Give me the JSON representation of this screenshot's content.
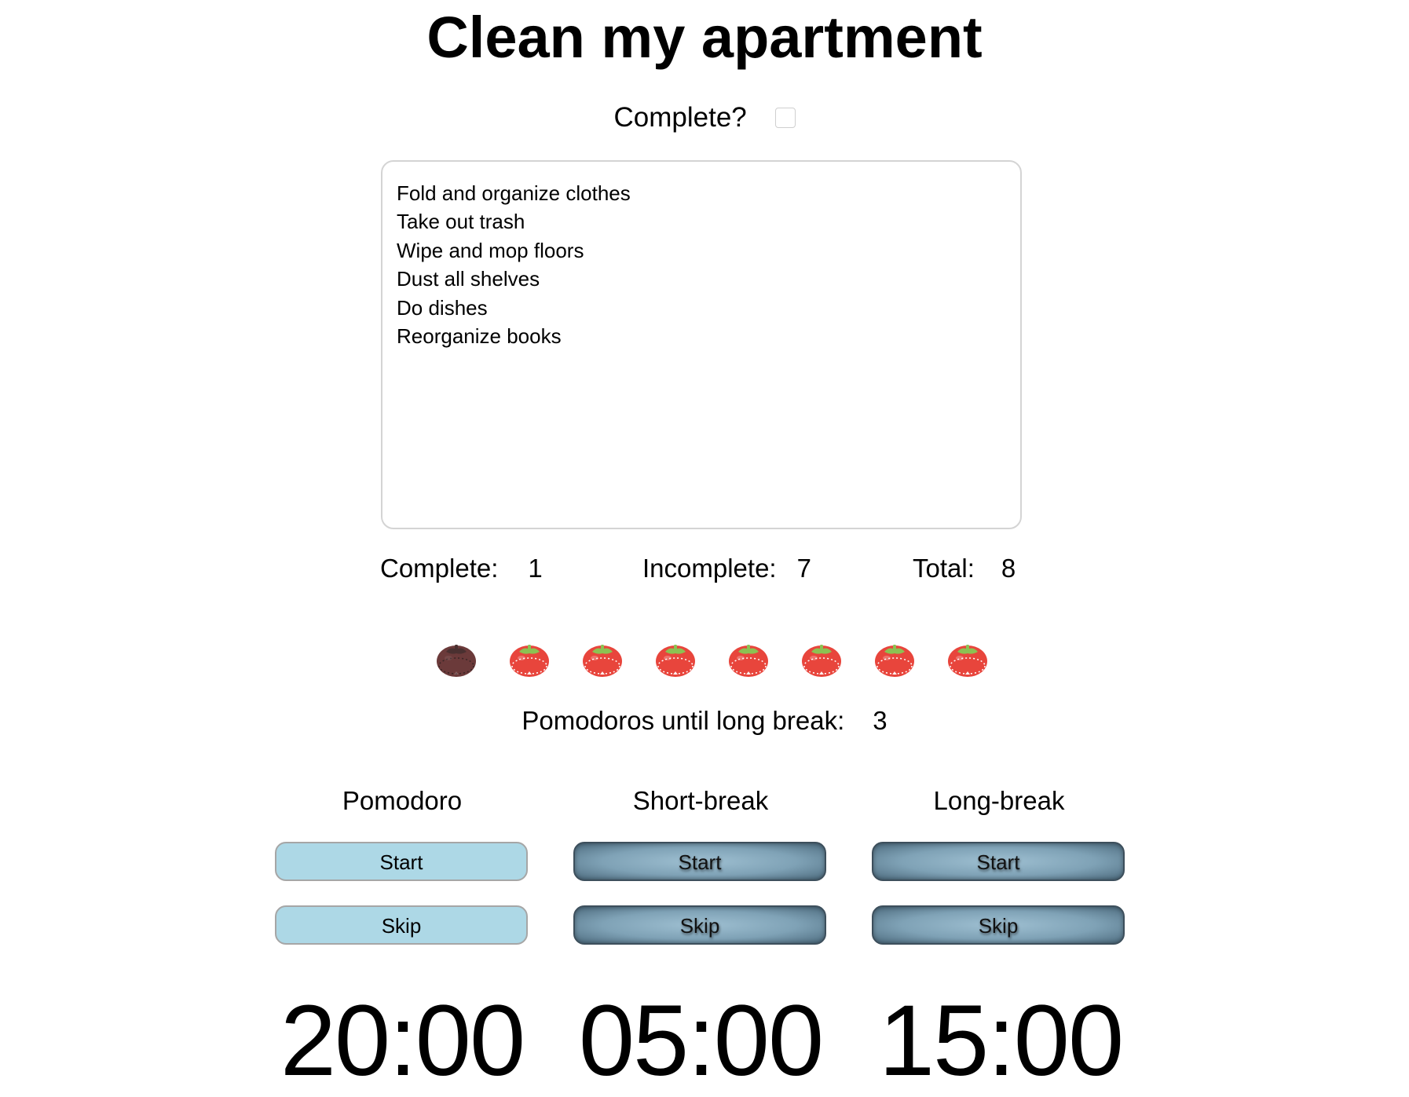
{
  "task": {
    "title": "Clean my apartment",
    "complete_label": "Complete?",
    "complete_checked": false,
    "notes": [
      "Fold and organize clothes",
      "Take out trash",
      "Wipe and mop floors",
      "Dust all shelves",
      "Do dishes",
      "Reorganize books"
    ]
  },
  "stats": {
    "complete_label": "Complete:",
    "complete_value": "1",
    "incomplete_label": "Incomplete:",
    "incomplete_value": "7",
    "total_label": "Total:",
    "total_value": "8"
  },
  "pomodoros": {
    "total": 8,
    "completed": 1,
    "icon": "tomato-timer-icon",
    "colors": {
      "active": "#e8453c",
      "completed": "#6b3a3a",
      "leaf": "#8cc152"
    },
    "until_long_break_label": "Pomodoros until long break:",
    "until_long_break_value": "3"
  },
  "timers": [
    {
      "id": "pomodoro",
      "heading": "Pomodoro",
      "start_label": "Start",
      "skip_label": "Skip",
      "time": "20:00",
      "active": true
    },
    {
      "id": "short",
      "heading": "Short-break",
      "start_label": "Start",
      "skip_label": "Skip",
      "time": "05:00",
      "active": false
    },
    {
      "id": "long",
      "heading": "Long-break",
      "start_label": "Start",
      "skip_label": "Skip",
      "time": "15:00",
      "active": false
    }
  ],
  "colors": {
    "active_button": "#add8e6",
    "inactive_button": "#7fa2b6"
  }
}
